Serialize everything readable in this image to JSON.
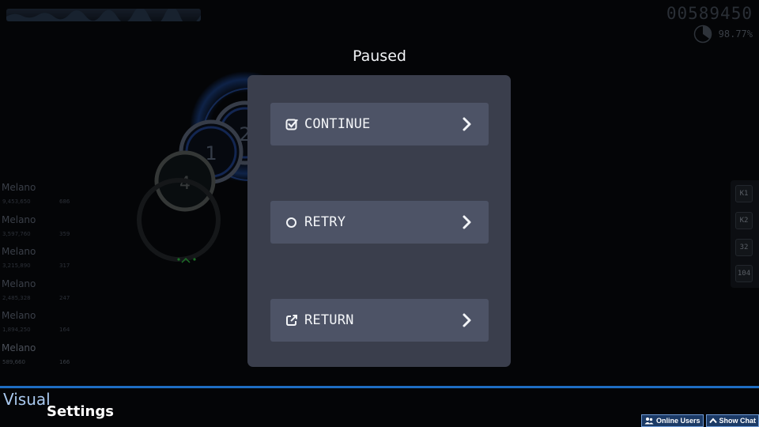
{
  "hud": {
    "score": "00589450",
    "accuracy": "98.77%",
    "accuracy_pie_fraction": 0.35
  },
  "playfield": {
    "circles": [
      "1",
      "2",
      "4"
    ]
  },
  "leaderboard": [
    {
      "name": "Melano",
      "score": "9,453,650",
      "combo": "686"
    },
    {
      "name": "Melano",
      "score": "3,597,760",
      "combo": "359"
    },
    {
      "name": "Melano",
      "score": "3,215,890",
      "combo": "317"
    },
    {
      "name": "Melano",
      "score": "2,485,328",
      "combo": "247"
    },
    {
      "name": "Melano",
      "score": "1,894,250",
      "combo": "164"
    },
    {
      "name": "Melano",
      "score": "589,660",
      "combo": "166"
    }
  ],
  "keys": [
    "K1",
    "K2",
    "32",
    "104"
  ],
  "pause": {
    "title": "Paused",
    "buttons": [
      {
        "label": "CONTINUE",
        "icon": "check-square-icon"
      },
      {
        "label": "RETRY",
        "icon": "circle-icon"
      },
      {
        "label": "RETURN",
        "icon": "external-link-icon"
      }
    ]
  },
  "footer": {
    "visual": "Visual",
    "settings": "Settings",
    "online_users": "Online Users",
    "show_chat": "Show Chat"
  },
  "colors": {
    "panel": "#3a3e4c",
    "button": "#4d5366",
    "accent_blue": "#1f6dc2"
  }
}
